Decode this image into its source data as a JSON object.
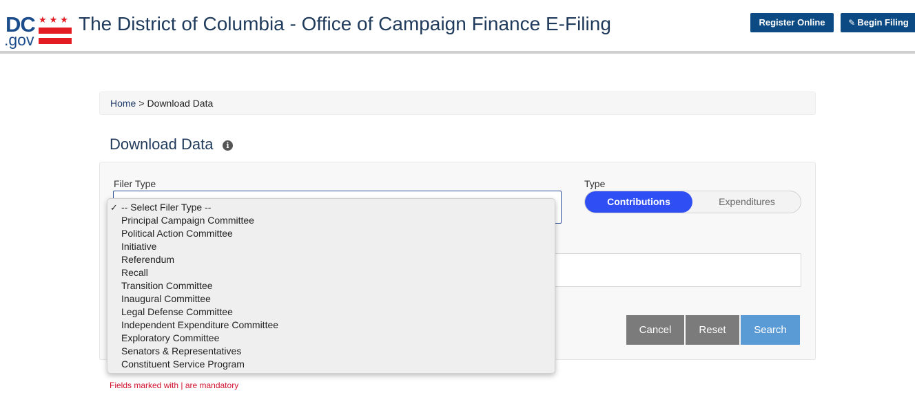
{
  "header": {
    "logo": {
      "dc": "DC",
      "gov": ".gov",
      "stars": "★★★"
    },
    "title": "The District of Columbia - Office of Campaign Finance E-Filing",
    "register_label": "Register Online",
    "begin_label": "Begin Filing",
    "begin_icon": "edit-icon",
    "button_color": "#0b4a83"
  },
  "breadcrumb": {
    "home": "Home",
    "separator": ">",
    "current": "Download Data"
  },
  "page": {
    "title": "Download Data",
    "info_icon": "info-icon"
  },
  "form": {
    "filer_type_label": "Filer Type",
    "type_label": "Type",
    "type_toggle": {
      "selected": "Contributions",
      "other": "Expenditures",
      "active_color": "#2f4ff5"
    },
    "cancel_label": "Cancel",
    "reset_label": "Reset",
    "search_label": "Search",
    "mandatory_note": "Fields marked with | are mandatory"
  },
  "filer_type_dropdown": {
    "selected_index": 0,
    "options": [
      "-- Select Filer Type --",
      "Principal Campaign Committee",
      "Political Action Committee",
      "Initiative",
      "Referendum",
      "Recall",
      "Transition Committee",
      "Inaugural Committee",
      "Legal Defense Committee",
      "Independent Expenditure Committee",
      "Exploratory Committee",
      "Senators & Representatives",
      "Constituent Service Program"
    ]
  }
}
